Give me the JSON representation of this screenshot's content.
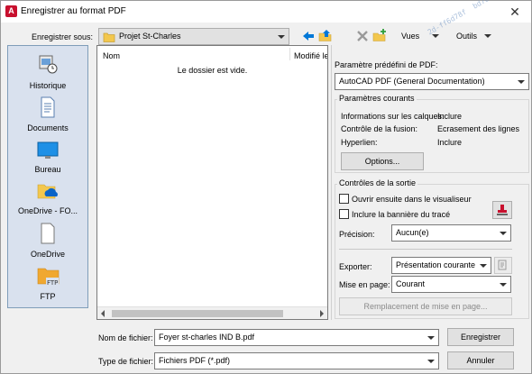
{
  "window": {
    "title": "Enregistrer au format PDF",
    "app_icon_letter": "A",
    "close_glyph": "✕"
  },
  "watermark": "2d-ff6d78f  bd701c6 ffaea3 6 fe8  d6eb-4761",
  "toolbar": {
    "save_in_label": "Enregistrer sous:",
    "folder_value": "Projet St-Charles",
    "views_label": "Vues",
    "tools_label": "Outils"
  },
  "places": [
    {
      "label": "Historique",
      "icon": "history-icon"
    },
    {
      "label": "Documents",
      "icon": "documents-icon"
    },
    {
      "label": "Bureau",
      "icon": "desktop-icon"
    },
    {
      "label": "OneDrive - FO...",
      "icon": "onedrive-business-icon"
    },
    {
      "label": "OneDrive",
      "icon": "onedrive-icon"
    },
    {
      "label": "FTP",
      "icon": "ftp-folder-icon"
    }
  ],
  "filelist": {
    "col_name": "Nom",
    "col_modified": "Modifié le",
    "empty_text": "Le dossier est vide."
  },
  "pdf": {
    "preset_label": "Paramètre prédéfini de PDF:",
    "preset_value": "AutoCAD PDF (General Documentation)",
    "current_group": "Paramètres courants",
    "rows": [
      {
        "key": "Informations sur les calques:",
        "value": "Inclure"
      },
      {
        "key": "Contrôle de la fusion:",
        "value": "Ecrasement des lignes"
      },
      {
        "key": "Hyperlien:",
        "value": "Inclure"
      }
    ],
    "options_button": "Options...",
    "output_group": "Contrôles de la sortie",
    "open_viewer": "Ouvrir ensuite dans le visualiseur",
    "include_banner": "Inclure la bannière du tracé",
    "precision_label": "Précision:",
    "precision_value": "Aucun(e)",
    "export_label": "Exporter:",
    "export_value": "Présentation courante",
    "pagesetup_label": "Mise en page:",
    "pagesetup_value": "Courant",
    "override_button": "Remplacement de mise en page..."
  },
  "bottom": {
    "filename_label": "Nom de fichier:",
    "filename_value": "Foyer st-charles IND B.pdf",
    "filetype_label": "Type de fichier:",
    "filetype_value": "Fichiers PDF (*.pdf)",
    "save_button": "Enregistrer",
    "cancel_button": "Annuler"
  },
  "colors": {
    "accent_blue": "#0078d7",
    "folder_yellow": "#f3c74d",
    "places_bg": "#d9e1ee",
    "delete_gray": "#9a9a9a",
    "stamp_red": "#c8102e"
  }
}
